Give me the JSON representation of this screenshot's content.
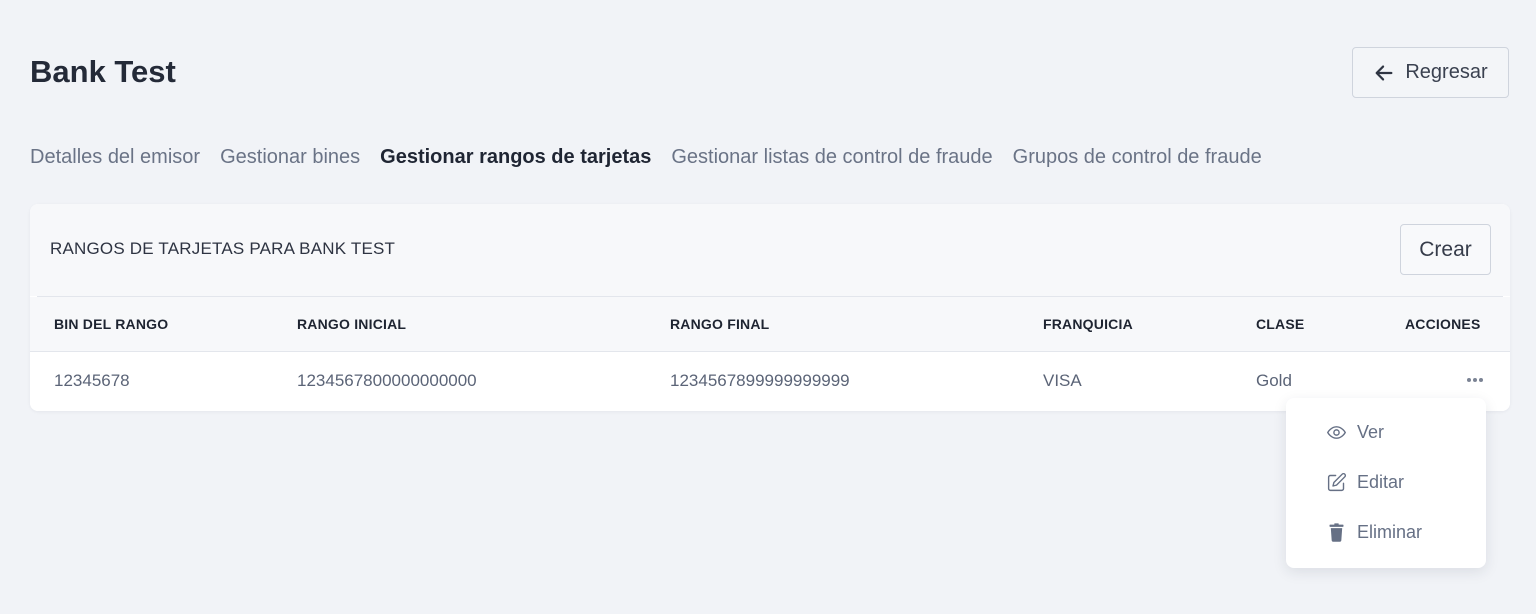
{
  "header": {
    "title": "Bank Test",
    "back_label": "Regresar"
  },
  "tabs": [
    {
      "label": "Detalles del emisor",
      "active": false
    },
    {
      "label": "Gestionar bines",
      "active": false
    },
    {
      "label": "Gestionar rangos de tarjetas",
      "active": true
    },
    {
      "label": "Gestionar listas de control de fraude",
      "active": false
    },
    {
      "label": "Grupos de control de fraude",
      "active": false
    }
  ],
  "card": {
    "title": "RANGOS DE TARJETAS PARA BANK TEST",
    "create_label": "Crear"
  },
  "table": {
    "columns": [
      "BIN DEL RANGO",
      "RANGO INICIAL",
      "RANGO FINAL",
      "FRANQUICIA",
      "CLASE",
      "ACCIONES"
    ],
    "rows": [
      [
        "12345678",
        "1234567800000000000",
        "1234567899999999999",
        "VISA",
        "Gold"
      ]
    ]
  },
  "actions_menu": {
    "items": [
      {
        "label": "Ver",
        "icon": "eye-icon"
      },
      {
        "label": "Editar",
        "icon": "edit-icon"
      },
      {
        "label": "Eliminar",
        "icon": "trash-icon"
      }
    ]
  },
  "colors": {
    "background": "#f1f3f7",
    "text_primary": "#242a38",
    "text_muted": "#6a7386",
    "border": "#cfd4dd"
  }
}
